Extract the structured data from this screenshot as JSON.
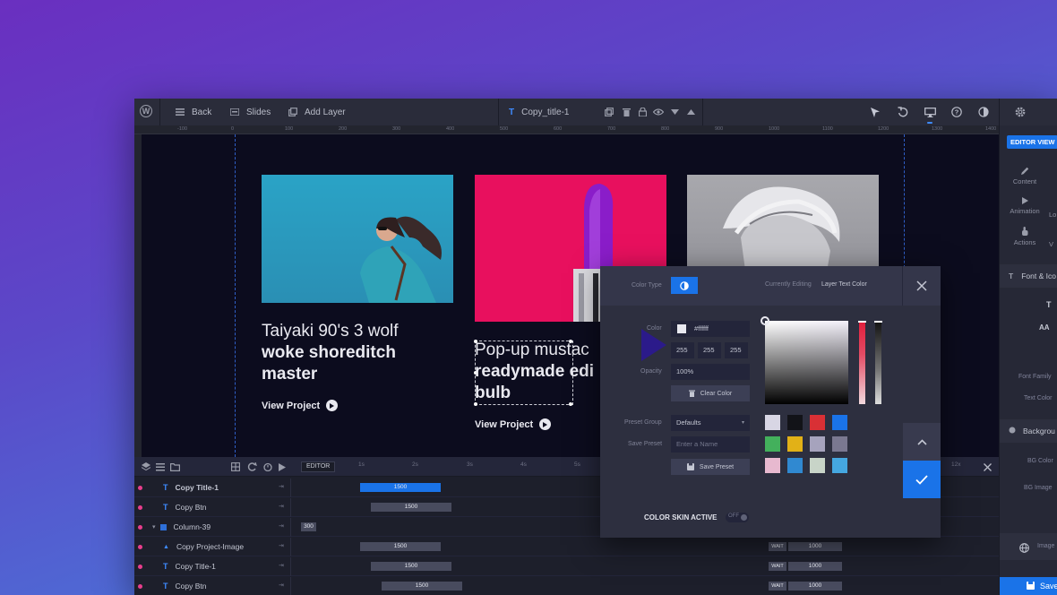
{
  "toolbar": {
    "back_label": "Back",
    "slides_label": "Slides",
    "add_layer_label": "Add Layer",
    "layer_name": "Copy_title-1"
  },
  "ruler": {
    "ticks": [
      "-100",
      "0",
      "100",
      "200",
      "300",
      "400",
      "500",
      "600",
      "700",
      "800",
      "900",
      "1000",
      "1100",
      "1200",
      "1300",
      "1400"
    ]
  },
  "canvas": {
    "card1": {
      "title_light": "Taiyaki 90's 3 wolf",
      "title_bold": "woke shoreditch master",
      "link": "View Project"
    },
    "card2": {
      "title_light": "Pop-up mustac",
      "title_bold": "readymade edi bulb",
      "link": "View Project"
    }
  },
  "right_panel": {
    "editor_view": "EDITOR VIEW",
    "tabs": [
      "Content",
      "Animation",
      "Actions"
    ],
    "tab_partial": [
      "Lo",
      "V"
    ],
    "section_font": "Font & Ico",
    "font_family_label": "Font Family",
    "text_color_label": "Text Color",
    "section_background": "Backgrou",
    "bg_color_label": "BG Color",
    "bg_image_label": "BG Image",
    "image_label": "Image",
    "save_label": "Save"
  },
  "timeline": {
    "editor_label": "EDITOR",
    "ticks": [
      "1s",
      "2s",
      "3s",
      "4s",
      "5s"
    ],
    "zoom": "12x",
    "rows": [
      {
        "name": "Copy Title-1",
        "type": "text",
        "bar": "1500",
        "active": true
      },
      {
        "name": "Copy Btn",
        "type": "text",
        "bar": "1500"
      },
      {
        "name": "Column-39",
        "type": "column",
        "bar": "300"
      },
      {
        "name": "Copy Project-Image",
        "type": "image",
        "bar": "1500",
        "wait": "WAIT",
        "wait_value": "1000"
      },
      {
        "name": "Copy Title-1",
        "type": "text",
        "bar": "1500",
        "wait": "WAIT",
        "wait_value": "1000"
      },
      {
        "name": "Copy Btn",
        "type": "text",
        "bar": "1500",
        "wait": "WAIT",
        "wait_value": "1000"
      }
    ]
  },
  "color_dialog": {
    "color_type_label": "Color Type",
    "currently_editing_label": "Currently Editing",
    "currently_editing_value": "Layer Text Color",
    "color_label": "Color",
    "hex_value": "#ffffff",
    "rgb_r": "255",
    "rgb_g": "255",
    "rgb_b": "255",
    "opacity_label": "Opacity",
    "opacity_value": "100%",
    "clear_color": "Clear Color",
    "preset_group_label": "Preset Group",
    "preset_group_value": "Defaults",
    "save_preset_label": "Save Preset",
    "preset_name_placeholder": "Enter a Name",
    "save_preset_button": "Save Preset",
    "skin_label": "COLOR SKIN ACTIVE",
    "skin_toggle": "OFF",
    "swatches": [
      "#d8d6e4",
      "#121318",
      "#d93035",
      "#1a73e8",
      "#43b05c",
      "#e2b117",
      "#a6a3bd",
      "#7a7890",
      "#e7b9cf",
      "#3089d1",
      "#c8d4c8",
      "#45a7e0"
    ]
  },
  "colors": {
    "accent": "#1a73e8",
    "card1_bg": "#2a9bc0",
    "card2_bg": "#e8105e",
    "pointer_marker": "#2b1a8a"
  }
}
